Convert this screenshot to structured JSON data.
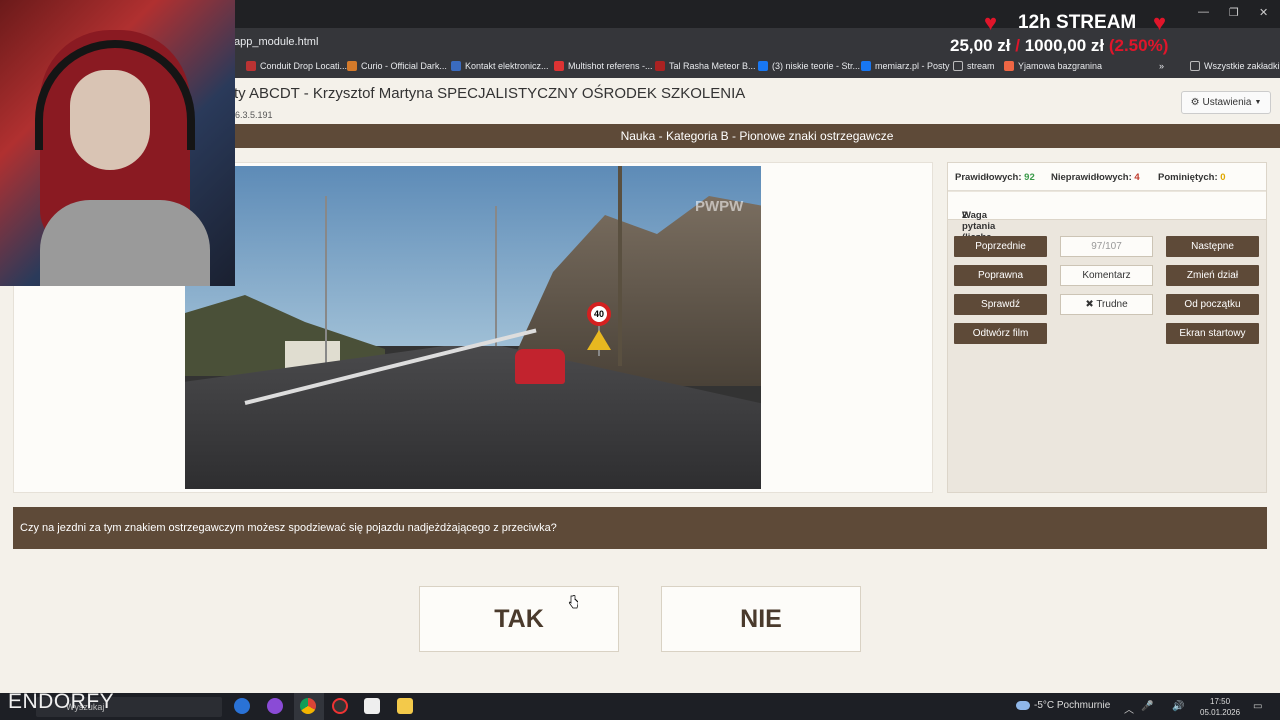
{
  "browser": {
    "url_fragment": "app_module.html",
    "bookmarks": [
      {
        "label": "Conduit Drop Locati...",
        "color": "#b33"
      },
      {
        "label": "Curio - Official Dark...",
        "color": "#d47a2a"
      },
      {
        "label": "Kontakt elektronicz...",
        "color": "#3a6bbf"
      },
      {
        "label": "Multishot referens -...",
        "color": "#d33"
      },
      {
        "label": "Tal Rasha Meteor B...",
        "color": "#a22"
      },
      {
        "label": "(3) niskie teorie - Str...",
        "color": "#1877f2"
      },
      {
        "label": "memiarz.pl - Posty",
        "color": "#1877f2"
      },
      {
        "label": "stream",
        "color": "#bbb"
      },
      {
        "label": "Yjamowa bazgranina",
        "color": "#e64"
      }
    ],
    "all_bookmarks": "Wszystkie zakładki",
    "window_controls": {
      "minimize": "—",
      "restore": "❐",
      "close": "✕"
    }
  },
  "stream_overlay": {
    "title": "12h STREAM",
    "heart": "♥",
    "raised": "25,00 zł",
    "separator": "/",
    "goal": "1000,00 zł",
    "percent": "(2.50%)"
  },
  "app": {
    "title": "ty ABCDT - Krzysztof Martyna SPECJALISTYCZNY OŚRODEK SZKOLENIA",
    "version": "6.3.5.191",
    "settings_label": "Ustawienia",
    "category_bar": "Nauka - Kategoria B - Pionowe znaki ostrzegawcze",
    "video_watermark": "PWPW",
    "video_sign_speed": "40"
  },
  "stats": {
    "correct_label": "Prawidłowych:",
    "correct_value": "92",
    "incorrect_label": "Nieprawidłowych:",
    "incorrect_value": "4",
    "skipped_label": "Pominiętych:",
    "skipped_value": "0",
    "weight_label": "Waga pytania (liczba punktów):",
    "weight_value": "2",
    "colors": {
      "correct": "#3a9a4a",
      "incorrect": "#c0392b",
      "skipped": "#e0a800"
    }
  },
  "controls": {
    "previous": "Poprzednie",
    "counter": "97/107",
    "next": "Następne",
    "correct_answer": "Poprawna",
    "comment": "Komentarz",
    "change_section": "Zmień dział",
    "check": "Sprawdź",
    "difficult": "✖ Trudne",
    "from_start": "Od początku",
    "play_film": "Odtwórz film",
    "start_screen": "Ekran startowy"
  },
  "question": {
    "text": "Czy na jezdni za tym znakiem ostrzegawczym możesz spodziewać się pojazdu nadjeżdżającego z przeciwka?"
  },
  "answers": {
    "yes": "TAK",
    "no": "NIE"
  },
  "taskbar": {
    "brand": "ENDORFY",
    "search_placeholder": "Wyszukaj",
    "weather": "-5°C  Pochmurnie",
    "time": "17:50",
    "date": "05.01.2026"
  }
}
